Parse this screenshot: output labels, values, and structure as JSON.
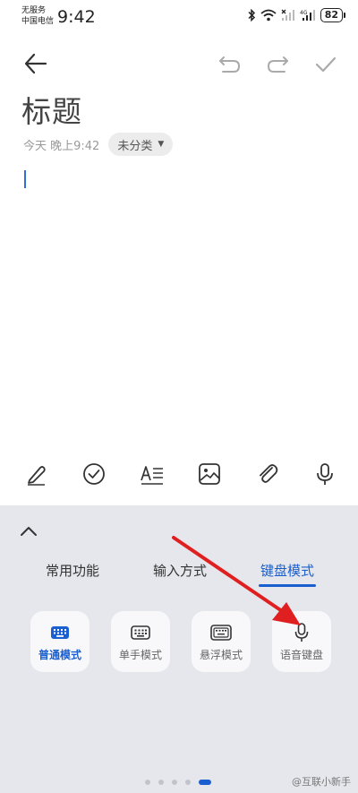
{
  "status_bar": {
    "carrier_line1": "无服务",
    "carrier_line2": "中国电信",
    "time": "9:42",
    "battery": "82"
  },
  "note": {
    "title": "标题",
    "date": "今天 晚上9:42",
    "category": "未分类"
  },
  "panel": {
    "tabs": [
      {
        "label": "常用功能"
      },
      {
        "label": "输入方式"
      },
      {
        "label": "键盘模式"
      }
    ],
    "active_tab": "键盘模式",
    "modes": [
      {
        "label": "普通模式",
        "icon": "keyboard-icon"
      },
      {
        "label": "单手模式",
        "icon": "keyboard-icon"
      },
      {
        "label": "悬浮模式",
        "icon": "floating-keyboard-icon"
      },
      {
        "label": "语音键盘",
        "icon": "microphone-icon"
      }
    ],
    "selected_mode": "普通模式",
    "page_indicator": {
      "count": 5,
      "active_index": 4
    }
  },
  "watermark": "@互联小新手",
  "colors": {
    "accent": "#1a5fcf",
    "panel_background": "#e6e7ec",
    "annotation_arrow": "#e02020"
  }
}
